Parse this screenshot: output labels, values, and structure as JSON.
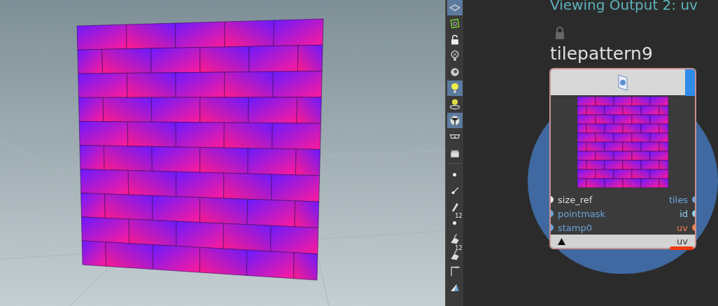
{
  "toolbar": [
    {
      "kind": "icon",
      "selected": true
    },
    {
      "kind": "icon",
      "selected": false
    },
    {
      "kind": "icon",
      "selected": false
    },
    {
      "kind": "icon",
      "selected": false
    },
    {
      "kind": "icon",
      "selected": false
    },
    {
      "kind": "icon",
      "selected": true
    },
    {
      "kind": "icon",
      "selected": false
    },
    {
      "kind": "icon",
      "selected": true
    },
    {
      "kind": "icon",
      "selected": false
    },
    {
      "kind": "icon",
      "selected": false
    },
    {
      "kind": "separator"
    },
    {
      "kind": "icon",
      "selected": false
    },
    {
      "kind": "icon",
      "selected": false
    },
    {
      "kind": "icon",
      "selected": false
    },
    {
      "kind": "numbered",
      "label": "12",
      "selected": false
    },
    {
      "kind": "icon",
      "selected": false
    },
    {
      "kind": "numbered",
      "label": "12",
      "selected": false
    },
    {
      "kind": "icon",
      "selected": false
    },
    {
      "kind": "icon",
      "selected": false
    }
  ],
  "network": {
    "viewing_label": "Viewing Output 2: uv",
    "node": {
      "name": "tilepattern9",
      "locked": true,
      "inputs": [
        {
          "label": "size_ref",
          "color": "#e6e6e6"
        },
        {
          "label": "pointmask",
          "color": "#6aa5dc"
        },
        {
          "label": "stamp0",
          "color": "#6aa5dc"
        }
      ],
      "outputs": [
        {
          "label": "tiles",
          "color": "#6aa5dc"
        },
        {
          "label": "id",
          "color": "#8fd3f4"
        },
        {
          "label": "uv",
          "color": "#f08050"
        }
      ],
      "footer_label": "uv"
    }
  }
}
